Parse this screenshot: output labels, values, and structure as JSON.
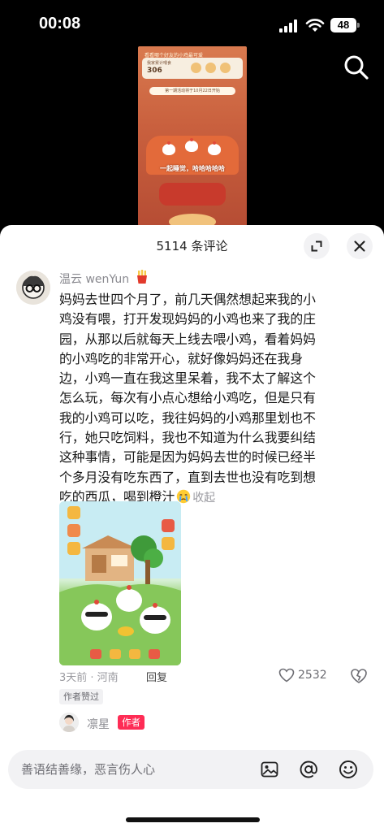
{
  "status_bar": {
    "time": "00:08",
    "battery": "48"
  },
  "video": {
    "top_text": "看看哪个好友的小鸡最可爱",
    "card_label": "我家累计喂食",
    "card_value": "306",
    "banner": "第一期活动将于10月22日开始",
    "caption": "一起睡觉，哈哈哈哈哈"
  },
  "comments_panel": {
    "title": "5114 条评论",
    "comment": {
      "username": "温云 wenYun",
      "text_lines": [
        "妈妈去世四个月了，前几天偶然想起来我的小",
        "鸡没有喂，打开发现妈妈的小鸡也来了我的庄",
        "园，从那以后就每天上线去喂小鸡，看着妈妈",
        "的小鸡吃的非常开心，就好像妈妈还在我身",
        "边，小鸡一直在我这里呆着，我不太了解这个",
        "怎么玩，每次有小点心想给小鸡吃，但是只有",
        "我的小鸡可以吃，我往妈妈的小鸡那里划也不",
        "行，她只吃饲料，我也不知道为什么我要纠结",
        "这种事情，可能是因为妈妈去世的时候已经半",
        "个多月没有吃东西了，直到去世也没有吃到想",
        "吃的西瓜，喝到橙汁"
      ],
      "collapse_label": "收起",
      "meta": "3天前 · 河南",
      "reply_label": "回复",
      "like_count": "2532",
      "author_liked": "作者赞过"
    },
    "reply": {
      "username": "凛星",
      "author_tag": "作者"
    },
    "input": {
      "placeholder": "善语结善缘，恶言伤人心"
    }
  }
}
